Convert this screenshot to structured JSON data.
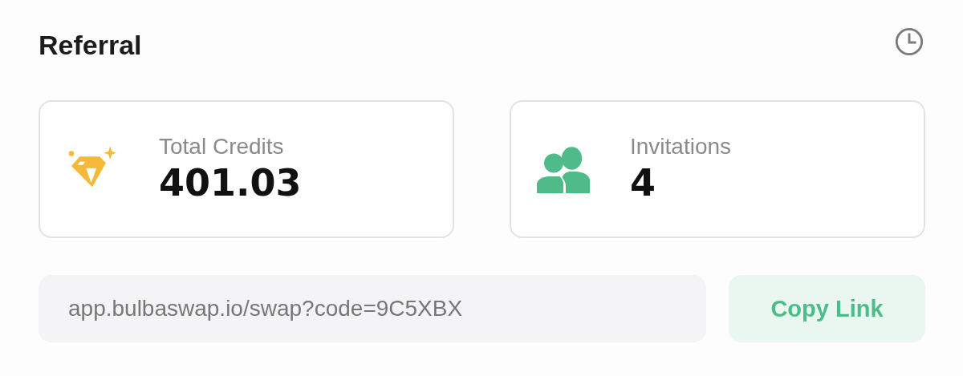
{
  "title": "Referral",
  "stats": [
    {
      "label": "Total Credits",
      "value": "401.03",
      "kind": "credits"
    },
    {
      "label": "Invitations",
      "value": "4",
      "kind": "invitations"
    }
  ],
  "link": {
    "value": "app.bulbaswap.io/swap?code=9C5XBX"
  },
  "copy_button": "Copy Link"
}
